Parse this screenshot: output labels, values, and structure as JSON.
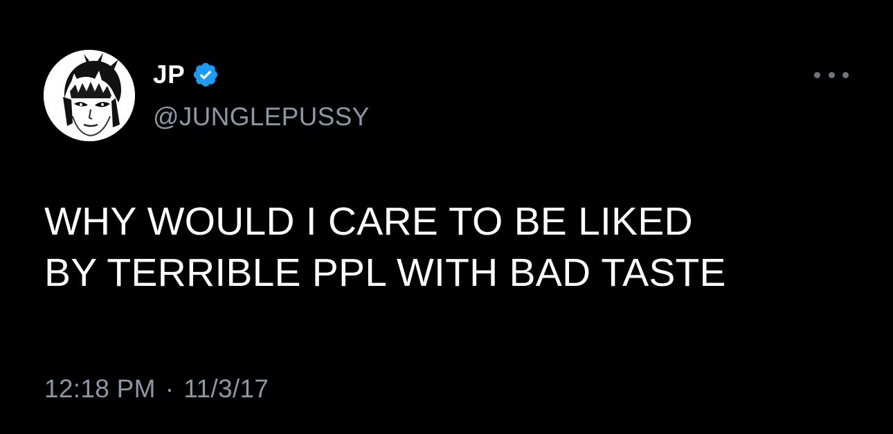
{
  "author": {
    "display_name": "JP",
    "handle": "@JUNGLEPUSSY",
    "verified": true,
    "avatar_icon": "profile-avatar-illustration"
  },
  "tweet": {
    "text": "WHY WOULD I CARE TO BE LIKED\nBY TERRIBLE PPL WITH BAD TASTE"
  },
  "meta": {
    "time": "12:18 PM",
    "separator": "·",
    "date": "11/3/17"
  },
  "icons": {
    "more": "more-horizontal-icon",
    "verified": "verified-badge-icon"
  },
  "colors": {
    "background": "#000000",
    "text": "#ffffff",
    "secondary_text": "#8b98a5",
    "verified_blue": "#1d9bf0"
  }
}
